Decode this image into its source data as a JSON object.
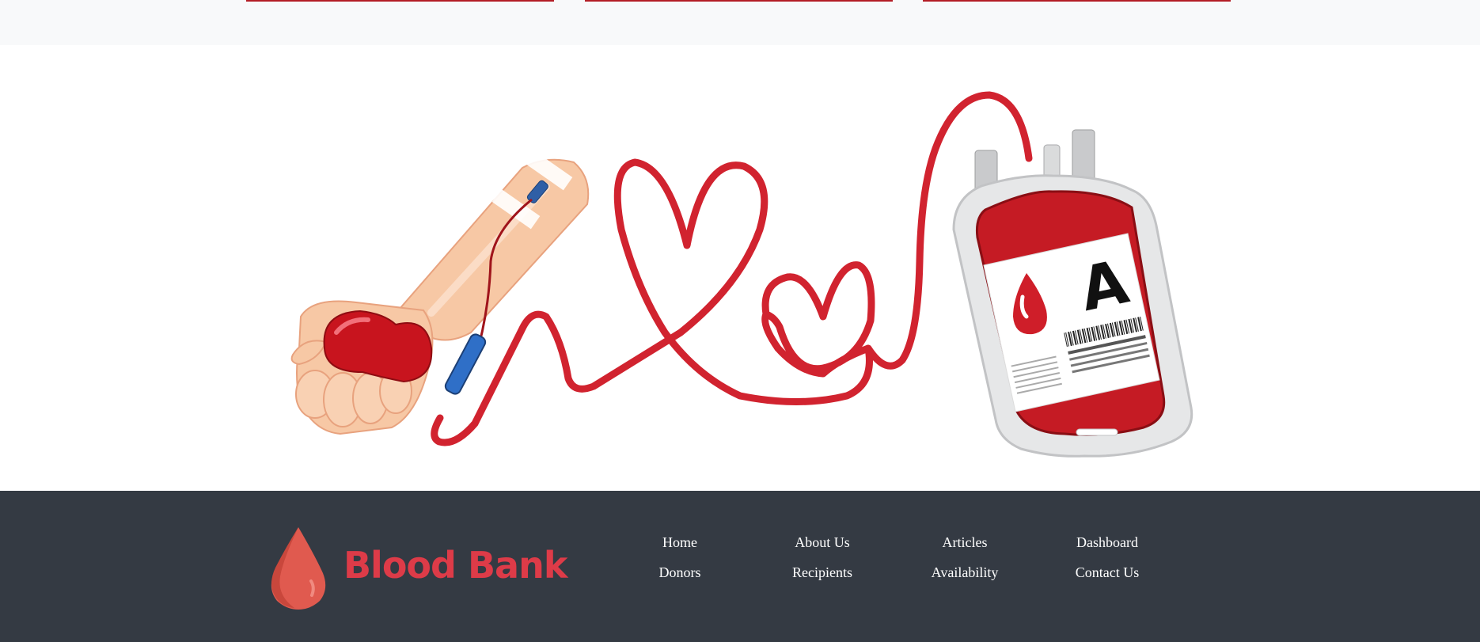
{
  "hero": {
    "illustration": "blood-donation-hand-to-blood-bag-illustration",
    "bag_label": "A",
    "colors": {
      "blood": "#d1232f",
      "blood_dark": "#9e1519",
      "tube": "#d42a33",
      "skin": "#f7c8a5",
      "bag_shell": "#e6e7e8"
    }
  },
  "footer": {
    "background": "#343a43",
    "brand": {
      "name": "Blood Bank",
      "color": "#dd3b48",
      "icon": "blood-drop-icon"
    },
    "nav": [
      {
        "label": "Home"
      },
      {
        "label": "About Us"
      },
      {
        "label": "Articles"
      },
      {
        "label": "Dashboard"
      },
      {
        "label": "Donors"
      },
      {
        "label": "Recipients"
      },
      {
        "label": "Availability"
      },
      {
        "label": "Contact Us"
      }
    ]
  }
}
